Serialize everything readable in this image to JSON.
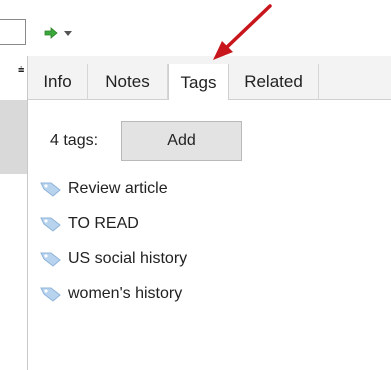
{
  "tabs": [
    {
      "id": "info",
      "label": "Info",
      "selected": false
    },
    {
      "id": "notes",
      "label": "Notes",
      "selected": false
    },
    {
      "id": "tags",
      "label": "Tags",
      "selected": true
    },
    {
      "id": "related",
      "label": "Related",
      "selected": false
    }
  ],
  "tags_panel": {
    "count_label": "4 tags:",
    "add_label": "Add",
    "tags": [
      {
        "label": "Review article"
      },
      {
        "label": "TO READ"
      },
      {
        "label": "US social history"
      },
      {
        "label": "women's history"
      }
    ]
  },
  "icons": {
    "locate": "green-arrow-icon",
    "dropdown": "chevron-down-icon",
    "tag": "tag-icon",
    "annotation": "red-arrow-icon"
  },
  "colors": {
    "annotation_arrow": "#c8161d",
    "locate_arrow": "#3aa93a",
    "tag_icon": "#9ec3e6",
    "selected_tab": "#ffffff",
    "tab_bar": "#f3f3f3",
    "add_button": "#e3e3e3"
  }
}
